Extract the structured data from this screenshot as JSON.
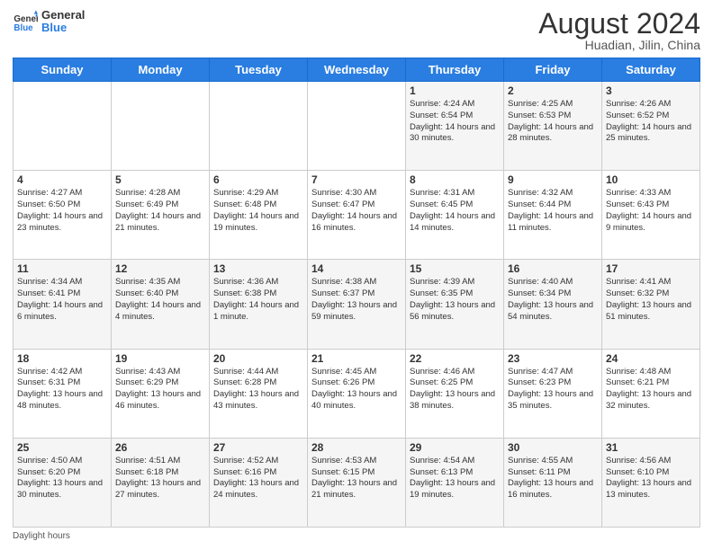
{
  "header": {
    "logo_line1": "General",
    "logo_line2": "Blue",
    "month_year": "August 2024",
    "location": "Huadian, Jilin, China"
  },
  "days_of_week": [
    "Sunday",
    "Monday",
    "Tuesday",
    "Wednesday",
    "Thursday",
    "Friday",
    "Saturday"
  ],
  "weeks": [
    [
      {
        "day": "",
        "content": ""
      },
      {
        "day": "",
        "content": ""
      },
      {
        "day": "",
        "content": ""
      },
      {
        "day": "",
        "content": ""
      },
      {
        "day": "1",
        "content": "Sunrise: 4:24 AM\nSunset: 6:54 PM\nDaylight: 14 hours and 30 minutes."
      },
      {
        "day": "2",
        "content": "Sunrise: 4:25 AM\nSunset: 6:53 PM\nDaylight: 14 hours and 28 minutes."
      },
      {
        "day": "3",
        "content": "Sunrise: 4:26 AM\nSunset: 6:52 PM\nDaylight: 14 hours and 25 minutes."
      }
    ],
    [
      {
        "day": "4",
        "content": "Sunrise: 4:27 AM\nSunset: 6:50 PM\nDaylight: 14 hours and 23 minutes."
      },
      {
        "day": "5",
        "content": "Sunrise: 4:28 AM\nSunset: 6:49 PM\nDaylight: 14 hours and 21 minutes."
      },
      {
        "day": "6",
        "content": "Sunrise: 4:29 AM\nSunset: 6:48 PM\nDaylight: 14 hours and 19 minutes."
      },
      {
        "day": "7",
        "content": "Sunrise: 4:30 AM\nSunset: 6:47 PM\nDaylight: 14 hours and 16 minutes."
      },
      {
        "day": "8",
        "content": "Sunrise: 4:31 AM\nSunset: 6:45 PM\nDaylight: 14 hours and 14 minutes."
      },
      {
        "day": "9",
        "content": "Sunrise: 4:32 AM\nSunset: 6:44 PM\nDaylight: 14 hours and 11 minutes."
      },
      {
        "day": "10",
        "content": "Sunrise: 4:33 AM\nSunset: 6:43 PM\nDaylight: 14 hours and 9 minutes."
      }
    ],
    [
      {
        "day": "11",
        "content": "Sunrise: 4:34 AM\nSunset: 6:41 PM\nDaylight: 14 hours and 6 minutes."
      },
      {
        "day": "12",
        "content": "Sunrise: 4:35 AM\nSunset: 6:40 PM\nDaylight: 14 hours and 4 minutes."
      },
      {
        "day": "13",
        "content": "Sunrise: 4:36 AM\nSunset: 6:38 PM\nDaylight: 14 hours and 1 minute."
      },
      {
        "day": "14",
        "content": "Sunrise: 4:38 AM\nSunset: 6:37 PM\nDaylight: 13 hours and 59 minutes."
      },
      {
        "day": "15",
        "content": "Sunrise: 4:39 AM\nSunset: 6:35 PM\nDaylight: 13 hours and 56 minutes."
      },
      {
        "day": "16",
        "content": "Sunrise: 4:40 AM\nSunset: 6:34 PM\nDaylight: 13 hours and 54 minutes."
      },
      {
        "day": "17",
        "content": "Sunrise: 4:41 AM\nSunset: 6:32 PM\nDaylight: 13 hours and 51 minutes."
      }
    ],
    [
      {
        "day": "18",
        "content": "Sunrise: 4:42 AM\nSunset: 6:31 PM\nDaylight: 13 hours and 48 minutes."
      },
      {
        "day": "19",
        "content": "Sunrise: 4:43 AM\nSunset: 6:29 PM\nDaylight: 13 hours and 46 minutes."
      },
      {
        "day": "20",
        "content": "Sunrise: 4:44 AM\nSunset: 6:28 PM\nDaylight: 13 hours and 43 minutes."
      },
      {
        "day": "21",
        "content": "Sunrise: 4:45 AM\nSunset: 6:26 PM\nDaylight: 13 hours and 40 minutes."
      },
      {
        "day": "22",
        "content": "Sunrise: 4:46 AM\nSunset: 6:25 PM\nDaylight: 13 hours and 38 minutes."
      },
      {
        "day": "23",
        "content": "Sunrise: 4:47 AM\nSunset: 6:23 PM\nDaylight: 13 hours and 35 minutes."
      },
      {
        "day": "24",
        "content": "Sunrise: 4:48 AM\nSunset: 6:21 PM\nDaylight: 13 hours and 32 minutes."
      }
    ],
    [
      {
        "day": "25",
        "content": "Sunrise: 4:50 AM\nSunset: 6:20 PM\nDaylight: 13 hours and 30 minutes."
      },
      {
        "day": "26",
        "content": "Sunrise: 4:51 AM\nSunset: 6:18 PM\nDaylight: 13 hours and 27 minutes."
      },
      {
        "day": "27",
        "content": "Sunrise: 4:52 AM\nSunset: 6:16 PM\nDaylight: 13 hours and 24 minutes."
      },
      {
        "day": "28",
        "content": "Sunrise: 4:53 AM\nSunset: 6:15 PM\nDaylight: 13 hours and 21 minutes."
      },
      {
        "day": "29",
        "content": "Sunrise: 4:54 AM\nSunset: 6:13 PM\nDaylight: 13 hours and 19 minutes."
      },
      {
        "day": "30",
        "content": "Sunrise: 4:55 AM\nSunset: 6:11 PM\nDaylight: 13 hours and 16 minutes."
      },
      {
        "day": "31",
        "content": "Sunrise: 4:56 AM\nSunset: 6:10 PM\nDaylight: 13 hours and 13 minutes."
      }
    ]
  ],
  "footer": {
    "daylight_label": "Daylight hours"
  }
}
